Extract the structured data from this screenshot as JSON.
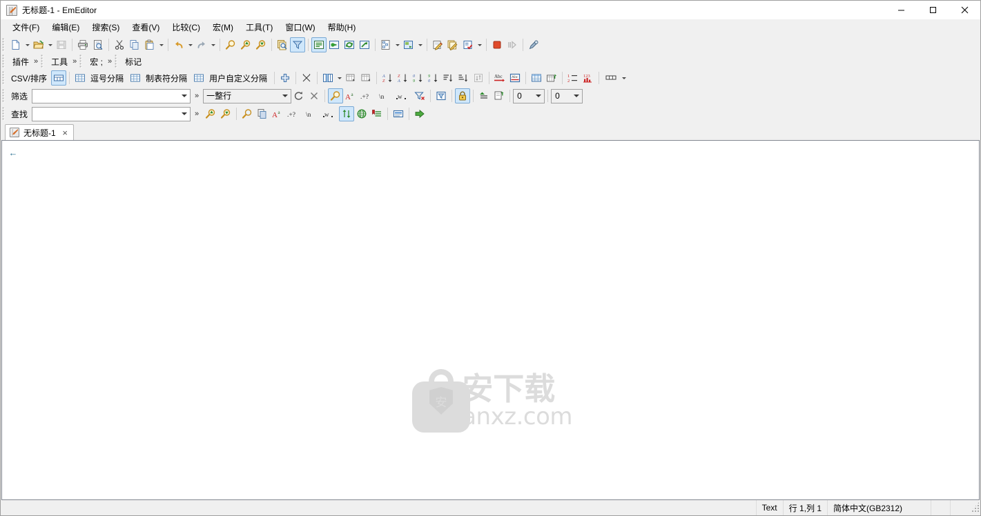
{
  "window": {
    "title": "无标题-1 - EmEditor",
    "app_icon": "emeditor-document-icon",
    "controls": {
      "minimize": "minimize-icon",
      "maximize": "maximize-icon",
      "close": "close-icon"
    }
  },
  "menubar": {
    "items": [
      {
        "label": "文件(F)",
        "name": "menu-file"
      },
      {
        "label": "编辑(E)",
        "name": "menu-edit"
      },
      {
        "label": "搜索(S)",
        "name": "menu-search"
      },
      {
        "label": "查看(V)",
        "name": "menu-view"
      },
      {
        "label": "比较(C)",
        "name": "menu-compare"
      },
      {
        "label": "宏(M)",
        "name": "menu-macro"
      },
      {
        "label": "工具(T)",
        "name": "menu-tools"
      },
      {
        "label": "窗口(W)",
        "name": "menu-window"
      },
      {
        "label": "帮助(H)",
        "name": "menu-help"
      }
    ]
  },
  "standard_toolbar": {
    "buttons": [
      {
        "name": "new-file-icon",
        "tip": "新建"
      },
      {
        "name": "new-file-dropdown",
        "tip": "新建下拉"
      },
      {
        "name": "open-file-icon",
        "tip": "打开"
      },
      {
        "name": "open-file-dropdown",
        "tip": "打开下拉"
      },
      {
        "name": "save-icon",
        "tip": "保存"
      },
      {
        "name": "print-icon",
        "tip": "打印"
      },
      {
        "name": "print-preview-icon",
        "tip": "打印预览"
      },
      {
        "name": "cut-icon",
        "tip": "剪切"
      },
      {
        "name": "copy-icon",
        "tip": "复制"
      },
      {
        "name": "paste-icon",
        "tip": "粘贴"
      },
      {
        "name": "paste-dropdown",
        "tip": "粘贴下拉"
      },
      {
        "name": "undo-icon",
        "tip": "撤销"
      },
      {
        "name": "undo-dropdown",
        "tip": "撤销下拉"
      },
      {
        "name": "redo-icon",
        "tip": "重做"
      },
      {
        "name": "redo-dropdown",
        "tip": "重做下拉"
      },
      {
        "name": "find-icon",
        "tip": "查找"
      },
      {
        "name": "find-previous-icon",
        "tip": "查找上一个"
      },
      {
        "name": "find-next-icon",
        "tip": "查找下一个"
      },
      {
        "name": "find-in-files-icon",
        "tip": "在文件中查找"
      },
      {
        "name": "filter-icon",
        "tip": "筛选",
        "active": true
      },
      {
        "name": "word-wrap-icon",
        "tip": "自动换行",
        "active": true
      },
      {
        "name": "insert-icon",
        "tip": "插入"
      },
      {
        "name": "refresh-icon",
        "tip": "刷新"
      },
      {
        "name": "export-icon",
        "tip": "导出"
      },
      {
        "name": "outline-icon",
        "tip": "大纲"
      },
      {
        "name": "outline-dropdown",
        "tip": "大纲下拉"
      },
      {
        "name": "snippet-icon",
        "tip": "片段"
      },
      {
        "name": "snippet-dropdown",
        "tip": "片段下拉"
      },
      {
        "name": "macro-run-icon",
        "tip": "运行宏"
      },
      {
        "name": "macro-select-icon",
        "tip": "选择宏"
      },
      {
        "name": "macro-props-icon",
        "tip": "宏属性"
      },
      {
        "name": "macro-dropdown",
        "tip": "宏下拉"
      },
      {
        "name": "stop-icon",
        "tip": "停止"
      },
      {
        "name": "step-icon",
        "tip": "单步"
      },
      {
        "name": "customize-icon",
        "tip": "自定义"
      }
    ]
  },
  "plugin_bar": {
    "groups": [
      {
        "label": "插件",
        "name": "plugins-bar",
        "chevron": "»"
      },
      {
        "label": "工具",
        "name": "tools-bar",
        "chevron": "»"
      },
      {
        "label": "宏  ;",
        "name": "macros-bar",
        "chevron": "»"
      },
      {
        "label": "标记",
        "name": "marks-bar",
        "chevron": ""
      }
    ]
  },
  "csv_toolbar": {
    "label": "CSV/排序",
    "mode_buttons": [
      {
        "label": "",
        "name": "csv-normal-mode-button",
        "icon": "table-normal-icon",
        "active": true
      },
      {
        "label": "逗号分隔",
        "name": "csv-comma-button",
        "icon": "table-comma-icon",
        "active": false
      },
      {
        "label": "制表符分隔",
        "name": "csv-tab-button",
        "icon": "table-tab-icon",
        "active": false
      },
      {
        "label": "用户自定义分隔",
        "name": "csv-custom-button",
        "icon": "table-custom-icon",
        "active": false
      }
    ],
    "buttons": [
      {
        "name": "add-column-icon",
        "tip": "添加列"
      },
      {
        "name": "csv-convert-icon",
        "tip": "转换"
      },
      {
        "name": "column-select-icon",
        "tip": "列选择"
      },
      {
        "name": "column-select-dropdown",
        "tip": "列选择下拉"
      },
      {
        "name": "insert-column-icon",
        "tip": "插入列"
      },
      {
        "name": "delete-column-icon",
        "tip": "删除列"
      },
      {
        "name": "sort-az-icon",
        "tip": "升序排序 A-Z"
      },
      {
        "name": "sort-za-icon",
        "tip": "降序排序 Z-A"
      },
      {
        "name": "sort-09-icon",
        "tip": "数字升序 0-9"
      },
      {
        "name": "sort-90-icon",
        "tip": "数字降序 9-0"
      },
      {
        "name": "sort-ascending-icon",
        "tip": "升序"
      },
      {
        "name": "sort-descending-icon",
        "tip": "降序"
      },
      {
        "name": "sort-custom-icon",
        "tip": "自定义排序"
      },
      {
        "name": "spellcheck-icon",
        "tip": "拼写检查"
      },
      {
        "name": "dictionary-icon",
        "tip": "字典"
      },
      {
        "name": "table-grid-icon",
        "tip": "表格"
      },
      {
        "name": "table-insert-icon",
        "tip": "插入表格"
      },
      {
        "name": "numbering-icon",
        "tip": "编号"
      },
      {
        "name": "statistics-icon",
        "tip": "统计"
      },
      {
        "name": "column-width-icon",
        "tip": "列宽"
      },
      {
        "name": "column-width-dropdown",
        "tip": "列宽下拉"
      }
    ]
  },
  "filter_bar": {
    "label": "筛选",
    "input_value": "",
    "input_placeholder": "",
    "chevron": "»",
    "scope_value": "一整行",
    "scope_options": [
      "一整行"
    ],
    "buttons": [
      {
        "name": "filter-refresh-icon",
        "tip": "刷新筛选"
      },
      {
        "name": "filter-clear-icon",
        "tip": "清除筛选"
      },
      {
        "name": "filter-search-icon",
        "tip": "筛选查找",
        "active": true
      },
      {
        "name": "match-case-icon",
        "label": "Aa",
        "tip": "区分大小写"
      },
      {
        "name": "regex-icon",
        "label": ".+?",
        "tip": "正则表达式"
      },
      {
        "name": "escape-sequence-icon",
        "label": "\\n",
        "tip": "转义序列"
      },
      {
        "name": "whole-word-icon",
        "label": "w",
        "tip": "全字匹配"
      },
      {
        "name": "filter-exclude-icon",
        "tip": "排除筛选"
      },
      {
        "name": "filter-toggle-icon",
        "tip": "切换筛选"
      },
      {
        "name": "lock-icon",
        "tip": "锁定",
        "active": true
      },
      {
        "name": "filter-up-icon",
        "tip": "向上"
      },
      {
        "name": "filter-copy-icon",
        "tip": "复制结果"
      }
    ],
    "before_lines": {
      "value": "0",
      "name": "context-before-select"
    },
    "after_lines": {
      "value": "0",
      "name": "context-after-select"
    }
  },
  "find_bar": {
    "label": "查找",
    "input_value": "",
    "input_placeholder": "",
    "chevron": "»",
    "buttons": [
      {
        "name": "find-previous-icon",
        "tip": "查找上一个"
      },
      {
        "name": "find-next-icon",
        "tip": "查找下一个"
      },
      {
        "name": "find-all-icon",
        "tip": "查找全部"
      },
      {
        "name": "copy-matches-icon",
        "tip": "复制匹配"
      },
      {
        "name": "match-case-icon",
        "label": "Aa",
        "tip": "区分大小写"
      },
      {
        "name": "regex-icon",
        "label": ".+?",
        "tip": "正则表达式"
      },
      {
        "name": "escape-sequence-icon",
        "label": "\\n",
        "tip": "转义序列"
      },
      {
        "name": "whole-word-icon",
        "label": "w",
        "tip": "全字匹配"
      },
      {
        "name": "search-direction-icon",
        "tip": "搜索方向",
        "active": true
      },
      {
        "name": "search-global-icon",
        "tip": "全局搜索"
      },
      {
        "name": "bookmark-matches-icon",
        "tip": "标记匹配"
      },
      {
        "name": "highlight-matches-icon",
        "tip": "高亮匹配"
      },
      {
        "name": "find-go-icon",
        "tip": "执行查找"
      }
    ]
  },
  "tabs": [
    {
      "label": "无标题-1",
      "name": "doc-tab-untitled-1",
      "active": true,
      "close": "×"
    }
  ],
  "editor": {
    "content": "",
    "eof_marker": "←",
    "watermark": {
      "cn": "安下载",
      "en": "anxz.com",
      "badge": "安"
    }
  },
  "statusbar": {
    "file_type": "Text",
    "caret": "行 1,列 1",
    "encoding": "简体中文(GB2312)"
  },
  "colors": {
    "chrome": "#f0f0f0",
    "accent": "#cfe7fb",
    "accent_border": "#7aa9d4",
    "editor_bg": "#ffffff",
    "watermark": "#dcdcdc",
    "eof": "#2a6f92"
  }
}
